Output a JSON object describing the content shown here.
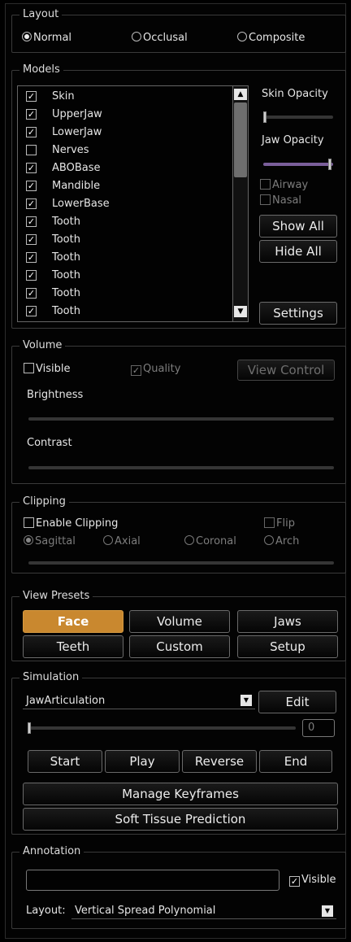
{
  "layout": {
    "title": "Layout",
    "options": [
      {
        "label": "Normal",
        "selected": true
      },
      {
        "label": "Occlusal",
        "selected": false
      },
      {
        "label": "Composite",
        "selected": false
      }
    ]
  },
  "models": {
    "title": "Models",
    "items": [
      {
        "label": "Skin",
        "checked": true
      },
      {
        "label": "UpperJaw",
        "checked": true
      },
      {
        "label": "LowerJaw",
        "checked": true
      },
      {
        "label": "Nerves",
        "checked": false
      },
      {
        "label": "ABOBase",
        "checked": true
      },
      {
        "label": "Mandible",
        "checked": true
      },
      {
        "label": "LowerBase",
        "checked": true
      },
      {
        "label": "Tooth",
        "checked": true
      },
      {
        "label": "Tooth",
        "checked": true
      },
      {
        "label": "Tooth",
        "checked": true
      },
      {
        "label": "Tooth",
        "checked": true
      },
      {
        "label": "Tooth",
        "checked": true
      },
      {
        "label": "Tooth",
        "checked": true
      }
    ],
    "skin_opacity_label": "Skin Opacity",
    "skin_opacity_value": 0.0,
    "jaw_opacity_label": "Jaw Opacity",
    "jaw_opacity_value": 1.0,
    "airway_label": "Airway",
    "nasal_label": "Nasal",
    "show_all_label": "Show All",
    "hide_all_label": "Hide All",
    "settings_label": "Settings"
  },
  "volume": {
    "title": "Volume",
    "visible_label": "Visible",
    "visible_checked": false,
    "quality_label": "Quality",
    "quality_checked": true,
    "view_control_label": "View Control",
    "brightness_label": "Brightness",
    "contrast_label": "Contrast"
  },
  "clipping": {
    "title": "Clipping",
    "enable_label": "Enable Clipping",
    "flip_label": "Flip",
    "planes": [
      {
        "label": "Sagittal",
        "selected": true
      },
      {
        "label": "Axial",
        "selected": false
      },
      {
        "label": "Coronal",
        "selected": false
      },
      {
        "label": "Arch",
        "selected": false
      }
    ]
  },
  "view_presets": {
    "title": "View Presets",
    "buttons": [
      "Face",
      "Volume",
      "Jaws",
      "Teeth",
      "Custom",
      "Setup"
    ],
    "active": "Face",
    "active_color": "#c9882f"
  },
  "simulation": {
    "title": "Simulation",
    "selected": "JawArticulation",
    "edit_label": "Edit",
    "frame_value": "0",
    "start_label": "Start",
    "play_label": "Play",
    "reverse_label": "Reverse",
    "end_label": "End",
    "manage_label": "Manage Keyframes",
    "soft_tissue_label": "Soft Tissue Prediction"
  },
  "annotation": {
    "title": "Annotation",
    "text_value": "",
    "visible_label": "Visible",
    "visible_checked": true,
    "layout_label": "Layout:",
    "layout_value": "Vertical Spread Polynomial"
  }
}
